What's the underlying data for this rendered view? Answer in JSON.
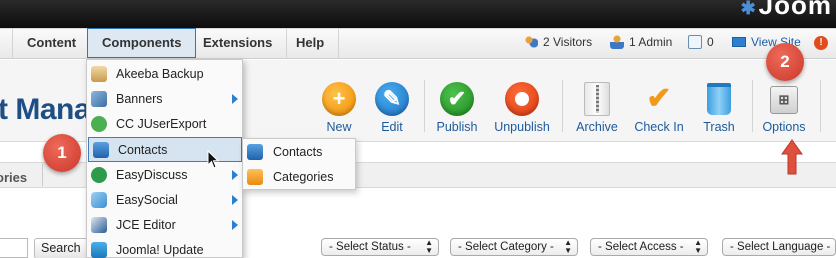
{
  "brand": {
    "text": "Joom"
  },
  "menubar": {
    "items": [
      {
        "label": "Content"
      },
      {
        "label": "Components"
      },
      {
        "label": "Extensions"
      },
      {
        "label": "Help"
      }
    ],
    "status": {
      "visitors": "2 Visitors",
      "admin": "1 Admin",
      "messages": "0",
      "view_site": "View Site"
    }
  },
  "page": {
    "title": "t Manag"
  },
  "toolbar": {
    "buttons": [
      {
        "label": "New",
        "icon": "plus-icon"
      },
      {
        "label": "Edit",
        "icon": "pencil-icon"
      },
      {
        "label": "Publish",
        "icon": "check-circle-icon"
      },
      {
        "label": "Unpublish",
        "icon": "unpublish-icon"
      },
      {
        "label": "Archive",
        "icon": "archive-icon"
      },
      {
        "label": "Check In",
        "icon": "checkmark-icon"
      },
      {
        "label": "Trash",
        "icon": "trash-icon"
      },
      {
        "label": "Options",
        "icon": "options-icon"
      }
    ]
  },
  "subnav": {
    "tab": "ories"
  },
  "filters": {
    "search_button": "Search",
    "selects": [
      "- Select Status -",
      "- Select Category -",
      "- Select Access -",
      "- Select Language -"
    ]
  },
  "components_menu": {
    "items": [
      {
        "label": "Akeeba Backup",
        "has_submenu": false
      },
      {
        "label": "Banners",
        "has_submenu": true
      },
      {
        "label": "CC JUserExport",
        "has_submenu": false
      },
      {
        "label": "Contacts",
        "has_submenu": true,
        "highlighted": true
      },
      {
        "label": "EasyDiscuss",
        "has_submenu": true
      },
      {
        "label": "EasySocial",
        "has_submenu": true
      },
      {
        "label": "JCE Editor",
        "has_submenu": true
      },
      {
        "label": "Joomla! Update",
        "has_submenu": false
      }
    ],
    "submenu": [
      {
        "label": "Contacts"
      },
      {
        "label": "Categories"
      }
    ]
  },
  "callouts": {
    "one": "1",
    "two": "2"
  },
  "colors": {
    "accent": "#2f77b9",
    "callout": "#d44a3a",
    "title": "#1d4f86"
  }
}
